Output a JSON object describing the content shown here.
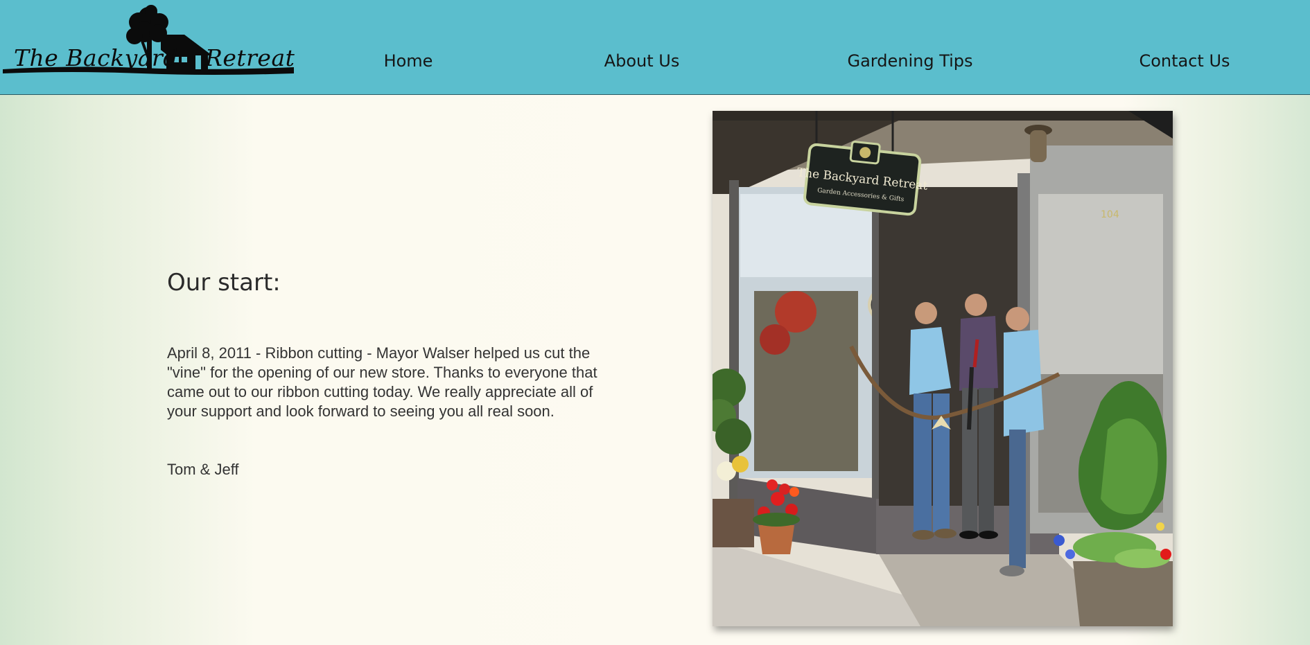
{
  "header": {
    "logo": {
      "text_left": "The Backyard",
      "text_right": "Retreat"
    },
    "nav": [
      {
        "label": "Home"
      },
      {
        "label": "About Us"
      },
      {
        "label": "Gardening Tips"
      },
      {
        "label": "Contact Us"
      }
    ]
  },
  "main": {
    "title": "Our start:",
    "paragraph": "April 8, 2011 - Ribbon cutting - Mayor Walser helped us cut the \"vine\" for the opening of our new store. Thanks to everyone that came out to our ribbon cutting today. We really appreciate all of your support and look forward to seeing you all real soon.",
    "signature": "Tom & Jeff",
    "photo": {
      "sign_title": "The Backyard Retreat",
      "sign_subtitle": "Garden Accessories & Gifts",
      "address_number": "104"
    }
  },
  "colors": {
    "header_bg": "#5bbecd",
    "page_bg": "#fdfaf1",
    "text": "#333333"
  }
}
